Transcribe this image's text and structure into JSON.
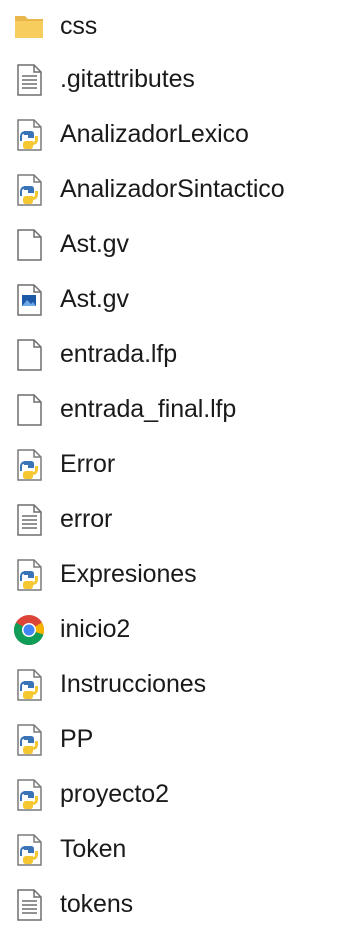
{
  "files": [
    {
      "name": "css",
      "icon": "folder-icon"
    },
    {
      "name": ".gitattributes",
      "icon": "text-file-icon"
    },
    {
      "name": "AnalizadorLexico",
      "icon": "python-file-icon"
    },
    {
      "name": "AnalizadorSintactico",
      "icon": "python-file-icon"
    },
    {
      "name": "Ast.gv",
      "icon": "blank-file-icon"
    },
    {
      "name": "Ast.gv",
      "icon": "image-file-icon"
    },
    {
      "name": "entrada.lfp",
      "icon": "blank-file-icon"
    },
    {
      "name": "entrada_final.lfp",
      "icon": "blank-file-icon"
    },
    {
      "name": "Error",
      "icon": "python-file-icon"
    },
    {
      "name": "error",
      "icon": "text-file-icon"
    },
    {
      "name": "Expresiones",
      "icon": "python-file-icon"
    },
    {
      "name": "inicio2",
      "icon": "chrome-icon"
    },
    {
      "name": "Instrucciones",
      "icon": "python-file-icon"
    },
    {
      "name": "PP",
      "icon": "python-file-icon"
    },
    {
      "name": "proyecto2",
      "icon": "python-file-icon"
    },
    {
      "name": "Token",
      "icon": "python-file-icon"
    },
    {
      "name": "tokens",
      "icon": "text-file-icon"
    }
  ]
}
